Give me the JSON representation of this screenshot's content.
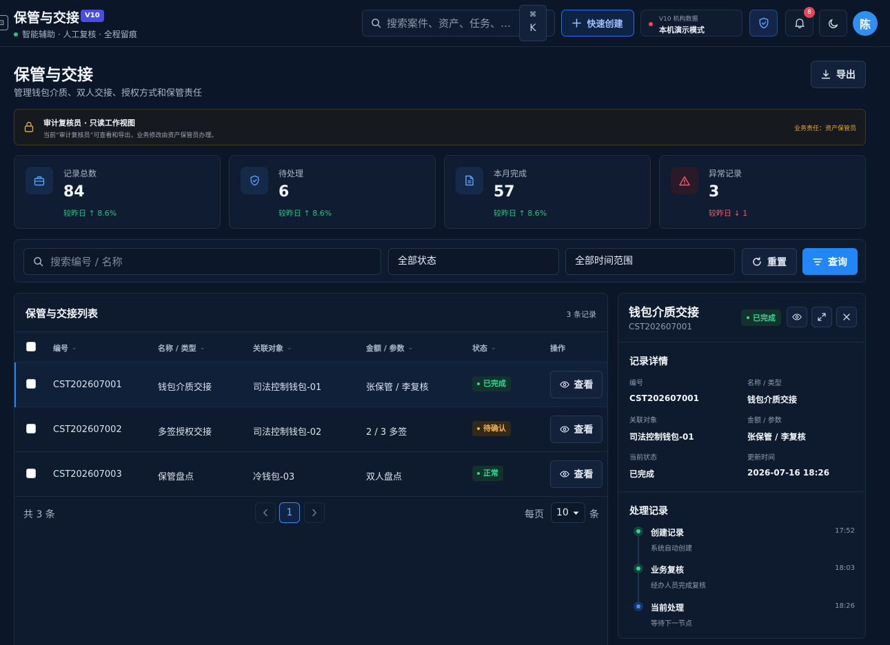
{
  "header": {
    "logo_glyph": "⊡",
    "app_title": "保管与交接",
    "version_badge": "V10",
    "subtitle": "智能辅助 · 人工复核 · 全程留痕",
    "search_placeholder": "搜索案件、资产、任务、…",
    "kbd_cmd": "⌘",
    "kbd_key": "K",
    "quick_create": "快速创建",
    "org_line1": "V10 机构数据",
    "org_line2": "本机演示模式",
    "notification_count": "8",
    "avatar": "陈"
  },
  "page": {
    "title": "保管与交接",
    "description": "管理钱包介质、双人交接、授权方式和保管责任",
    "export": "导出"
  },
  "notice": {
    "title": "审计复核员 · 只读工作视图",
    "text": "当前“审计复核员”可查看和导出，业务修改由资产保管员办理。",
    "responsibility": "业务责任：资产保管员"
  },
  "stats": [
    {
      "label": "记录总数",
      "value": "84",
      "trend": "较昨日 ↑ 8.6%",
      "icon": "briefcase-icon"
    },
    {
      "label": "待处理",
      "value": "6",
      "trend": "较昨日 ↑ 8.6%",
      "icon": "shield-icon"
    },
    {
      "label": "本月完成",
      "value": "57",
      "trend": "较昨日 ↑ 8.6%",
      "icon": "document-icon"
    },
    {
      "label": "异常记录",
      "value": "3",
      "trend": "较昨日 ↓ 1",
      "icon": "warning-icon"
    }
  ],
  "filters": {
    "search_placeholder": "搜索编号 / 名称",
    "status": "全部状态",
    "time": "全部时间范围",
    "reset": "重置",
    "query": "查询"
  },
  "table": {
    "title": "保管与交接列表",
    "count": "3 条记录",
    "columns": [
      "编号",
      "名称 / 类型",
      "关联对象",
      "金额 / 参数",
      "状态",
      "操作"
    ],
    "rows": [
      {
        "id": "CST202607001",
        "name": "钱包介质交接",
        "target": "司法控制钱包-01",
        "param": "张保管 / 李复核",
        "status": "已完成",
        "action": "查看"
      },
      {
        "id": "CST202607002",
        "name": "多签授权交接",
        "target": "司法控制钱包-02",
        "param": "2 / 3 多签",
        "status": "待确认",
        "action": "查看"
      },
      {
        "id": "CST202607003",
        "name": "保管盘点",
        "target": "冷钱包-03",
        "param": "双人盘点",
        "status": "正常",
        "action": "查看"
      }
    ],
    "pagination": {
      "total": "共 3 条",
      "current_page": "1",
      "per_page_label": "每页",
      "per_page": "10",
      "unit": "条"
    }
  },
  "detail": {
    "title": "钱包介质交接",
    "id": "CST202607001",
    "status": "已完成",
    "section_title": "记录详情",
    "fields": [
      {
        "label": "编号",
        "value": "CST202607001"
      },
      {
        "label": "名称 / 类型",
        "value": "钱包介质交接"
      },
      {
        "label": "关联对象",
        "value": "司法控制钱包-01"
      },
      {
        "label": "金额 / 参数",
        "value": "张保管 / 李复核"
      },
      {
        "label": "当前状态",
        "value": "已完成"
      },
      {
        "label": "更新时间",
        "value": "2026-07-16 18:26"
      }
    ],
    "timeline_title": "处理记录",
    "timeline": [
      {
        "title": "创建记录",
        "sub": "系统自动创建",
        "time": "17:52"
      },
      {
        "title": "业务复核",
        "sub": "经办人员完成复核",
        "time": "18:03"
      },
      {
        "title": "当前处理",
        "sub": "等待下一节点",
        "time": "18:26"
      }
    ]
  },
  "colors": {
    "background": "#0b1628",
    "accent": "#2287f5",
    "success": "#35d59a",
    "warning": "#f3b548",
    "danger": "#ef5a6a"
  }
}
